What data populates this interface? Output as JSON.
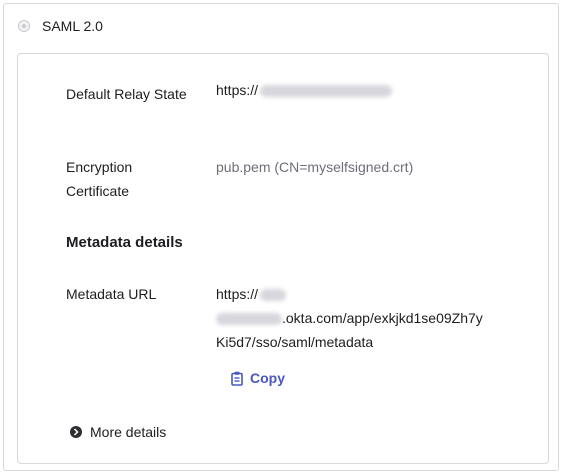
{
  "saml": {
    "radio_label": "SAML 2.0"
  },
  "relay": {
    "label": "Default Relay State",
    "prefix": "https://"
  },
  "cert": {
    "label_line1": "Encryption",
    "label_line2": "Certificate",
    "value": "pub.pem (CN=myselfsigned.crt)"
  },
  "metadata": {
    "heading": "Metadata details",
    "url_label": "Metadata URL",
    "url_line1_prefix": "https://",
    "url_line2_suffix": ".okta.com/app/exkjkd1se09Zh7y",
    "url_line3": "Ki5d7/sso/saml/metadata",
    "copy_label": "Copy"
  },
  "more_details": {
    "label": "More details"
  },
  "colors": {
    "accent": "#4a56c2",
    "border": "#d7d7dc"
  },
  "icons": {
    "copy": "clipboard-icon",
    "more": "chevron-right-circle-icon"
  }
}
